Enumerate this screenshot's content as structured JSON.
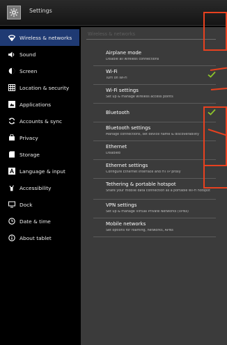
{
  "app": {
    "title": "Settings",
    "icon": "settings-gear-icon"
  },
  "sidebar": {
    "items": [
      {
        "label": "Wireless & networks",
        "icon": "wifi-icon",
        "selected": true
      },
      {
        "label": "Sound",
        "icon": "speaker-icon"
      },
      {
        "label": "Screen",
        "icon": "brightness-icon"
      },
      {
        "label": "Location & security",
        "icon": "grid-lock-icon"
      },
      {
        "label": "Applications",
        "icon": "applications-icon"
      },
      {
        "label": "Accounts & sync",
        "icon": "sync-icon"
      },
      {
        "label": "Privacy",
        "icon": "privacy-icon"
      },
      {
        "label": "Storage",
        "icon": "storage-icon"
      },
      {
        "label": "Language & input",
        "icon": "language-icon"
      },
      {
        "label": "Accessibility",
        "icon": "accessibility-icon"
      },
      {
        "label": "Dock",
        "icon": "dock-icon"
      },
      {
        "label": "Date & time",
        "icon": "clock-icon"
      },
      {
        "label": "About tablet",
        "icon": "info-icon"
      }
    ]
  },
  "panel": {
    "header": "Wireless & networks",
    "items": [
      {
        "title": "Airplane mode",
        "summary": "Disable all wireless connections",
        "checked": false
      },
      {
        "title": "Wi-Fi",
        "summary": "Turn on Wi-Fi",
        "checked": true
      },
      {
        "title": "Wi-Fi settings",
        "summary": "Set up & manage wireless access points",
        "checked": false
      },
      {
        "title": "Bluetooth",
        "summary": "",
        "checked": true
      },
      {
        "title": "Bluetooth settings",
        "summary": "Manage connections, set device name & discoverability",
        "checked": false
      },
      {
        "title": "Ethernet",
        "summary": "Disabled",
        "checked": false
      },
      {
        "title": "Ethernet settings",
        "summary": "Configure Ethernet interface and HTTP proxy",
        "checked": false
      },
      {
        "title": "Tethering & portable hotspot",
        "summary": "Share your mobile data connection as a portable Wi-Fi hotspot",
        "checked": false
      },
      {
        "title": "VPN settings",
        "summary": "Set up & manage Virtual Private Networks (VPNs)",
        "checked": false
      },
      {
        "title": "Mobile networks",
        "summary": "Set options for roaming, networks, APNs",
        "checked": false
      }
    ]
  },
  "colors": {
    "accent": "#1f3a73",
    "callout": "#e8411f",
    "check": "#8ec42b"
  }
}
